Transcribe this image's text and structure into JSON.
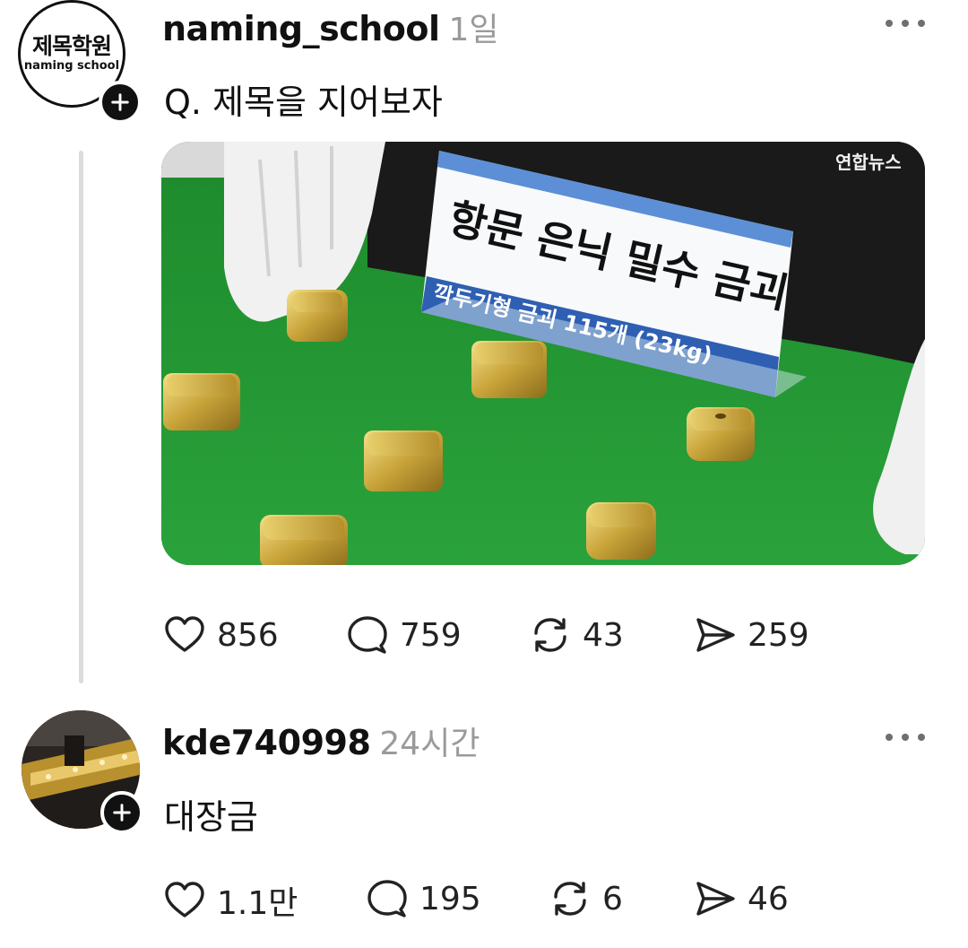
{
  "post": {
    "avatar": {
      "title_ko": "제목학원",
      "subtitle_en": "naming school"
    },
    "username": "naming_school",
    "time": "1일",
    "text": "Q. 제목을 지어보자",
    "image": {
      "watermark": "연합뉴스",
      "sign_title": "항문 은닉 밀수 금괴",
      "sign_subtitle": "깍두기형 금괴 115개 (23kg)"
    },
    "actions": {
      "likes": "856",
      "replies": "759",
      "reposts": "43",
      "shares": "259"
    }
  },
  "reply": {
    "username": "kde740998",
    "time": "24시간",
    "text": "대장금",
    "actions": {
      "likes": "1.1만",
      "replies": "195",
      "reposts": "6",
      "shares": "46"
    }
  },
  "icons": {
    "like": "heart-icon",
    "reply": "speech-bubble-icon",
    "repost": "repost-arrows-icon",
    "share": "send-icon",
    "follow": "plus-icon",
    "more": "more-dots-icon"
  }
}
